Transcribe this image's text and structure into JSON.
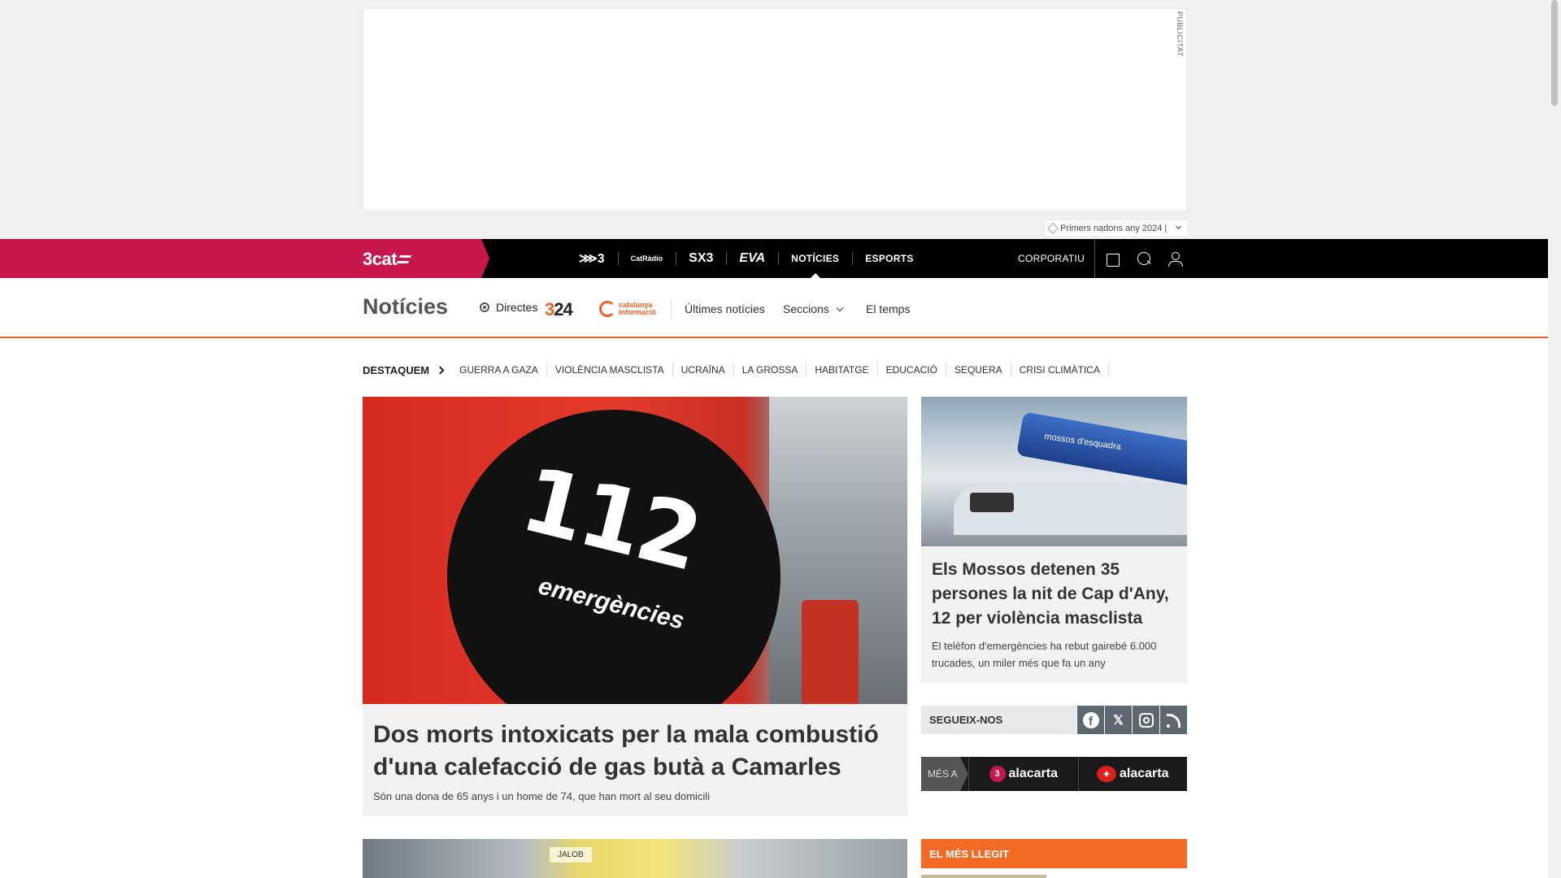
{
  "ad": {
    "label": "PUBLICITAT",
    "tag": "Primers nadons any 2024 |"
  },
  "topnav": {
    "logo": "3cat",
    "channels": [
      {
        "label": "⋙3",
        "icon": "tv3-logo"
      },
      {
        "label": "CatRàdio",
        "icon": "catradio-logo"
      },
      {
        "label": "SX3",
        "icon": "sx3-logo"
      },
      {
        "label": "EVA",
        "icon": "eva-logo"
      },
      {
        "label": "NOTÍCIES",
        "active": true
      },
      {
        "label": "ESPORTS"
      }
    ],
    "corporate": "CORPORATIU"
  },
  "section": {
    "title": "Notícies",
    "directes": "Directes",
    "logo_324": "24",
    "logo_324_prefix": "3",
    "logo_ci": "catalunya informació",
    "links": [
      "Últimes notícies",
      "Seccions",
      "El temps"
    ]
  },
  "destaquem": {
    "label": "DESTAQUEM",
    "tags": [
      "GUERRA A GAZA",
      "VIOLÈNCIA MASCLISTA",
      "UCRAÏNA",
      "LA GROSSA",
      "HABITATGE",
      "EDUCACIÓ",
      "SEQUERA",
      "CRISI CLIMÀTICA"
    ]
  },
  "hero": {
    "image_number": "112",
    "image_word": "emergències",
    "title": "Dos morts intoxicats per la mala combustió d'una calefacció de gas butà a Camarles",
    "subtitle": "Són una dona de 65 anys i un home de 74, que han mort al seu domicili"
  },
  "next_article": {
    "image_note": "JALOB"
  },
  "side_article": {
    "image_text": "mossos d'esquadra",
    "title": "Els Mossos detenen 35 persones la nit de Cap d'Any, 12 per violència masclista",
    "subtitle": "El telèfon d'emergències ha rebut gairebé 6.000 trucades, un miler més que fa un any"
  },
  "follow": {
    "label": "SEGUEIX-NOS",
    "networks": [
      "facebook",
      "x",
      "instagram",
      "rss"
    ]
  },
  "mesa": {
    "label": "MÉS A",
    "items": [
      {
        "badge": "3",
        "label": "alacarta"
      },
      {
        "badge": "✦",
        "label": "alacarta"
      }
    ]
  },
  "most_read": {
    "label": "EL MÉS LLEGIT"
  },
  "colors": {
    "brand": "#c8174d",
    "accent": "#f26a24",
    "nav_bg": "#000000"
  }
}
